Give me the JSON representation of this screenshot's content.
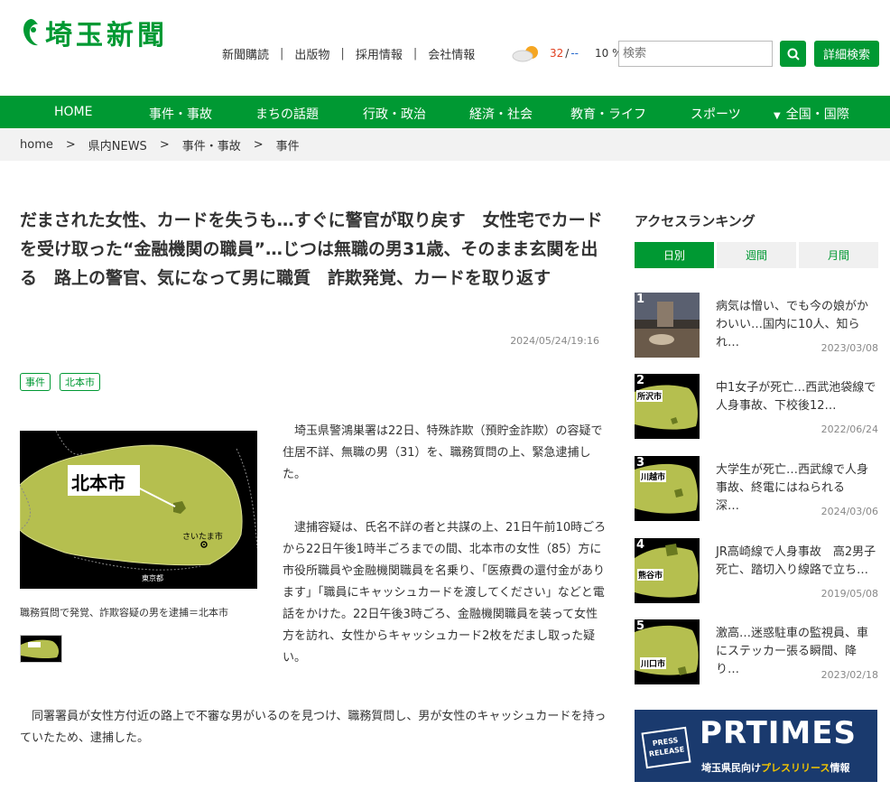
{
  "header": {
    "logo_text": "埼玉新聞",
    "links": [
      "新聞購読",
      "出版物",
      "採用情報",
      "会社情報"
    ],
    "weather": {
      "high": "32",
      "low": "--",
      "rain": "10 %"
    },
    "search_placeholder": "検索",
    "advanced_search": "詳細検索"
  },
  "nav": {
    "items": [
      "HOME",
      "事件・事故",
      "まちの話題",
      "行政・政治",
      "経済・社会",
      "教育・ライフ",
      "スポーツ",
      "全国・国際"
    ]
  },
  "breadcrumb": [
    "home",
    "県内NEWS",
    "事件・事故",
    "事件"
  ],
  "article": {
    "title": "だまされた女性、カードを失うも…すぐに警官が取り戻す　女性宅でカードを受け取った“金融機関の職員”…じつは無職の男31歳、そのまま玄関を出る　路上の警官、気になって男に職質　詐欺発覚、カードを取り返す",
    "date": "2024/05/24/19:16",
    "tags": [
      "事件",
      "北本市"
    ],
    "map_label": "北本市",
    "map_city": "さいたま市",
    "map_tokyo": "東京都",
    "caption": "職務質問で発覚、詐欺容疑の男を逮捕＝北本市",
    "paragraphs": [
      "　埼玉県警鴻巣署は22日、特殊詐欺（預貯金詐欺）の容疑で住居不詳、無職の男（31）を、職務質問の上、緊急逮捕した。",
      "　逮捕容疑は、氏名不詳の者と共謀の上、21日午前10時ごろから22日午後1時半ごろまでの間、北本市の女性（85）方に市役所職員や金融機関職員を名乗り、「医療費の還付金があります」「職員にキャッシュカードを渡してください」などと電話をかけた。22日午後3時ごろ、金融機関職員を装って女性方を訪れ、女性からキャッシュカード2枚をだまし取った疑い。",
      "　同署署員が女性方付近の路上で不審な男がいるのを見つけ、職務質問し、男が女性のキャッシュカードを持っていたため、逮捕した。"
    ]
  },
  "sidebar": {
    "title": "アクセスランキング",
    "tabs": [
      "日別",
      "週間",
      "月間"
    ],
    "ranking": [
      {
        "num": "1",
        "title": "病気は憎い、でも今の娘がかわいい…国内に10人、知られ…",
        "date": "2023/03/08"
      },
      {
        "num": "2",
        "title": "中1女子が死亡…西武池袋線で人身事故、下校後12…",
        "date": "2022/06/24",
        "map_label": "所沢市"
      },
      {
        "num": "3",
        "title": "大学生が死亡…西武線で人身事故、終電にはねられる　深…",
        "date": "2024/03/06",
        "map_label": "川越市"
      },
      {
        "num": "4",
        "title": "JR高崎線で人身事故　高2男子死亡、踏切入り線路で立ち…",
        "date": "2019/05/08",
        "map_label": "熊谷市"
      },
      {
        "num": "5",
        "title": "激高…迷惑駐車の監視員、車にステッカー張る瞬間、降り…",
        "date": "2023/02/18",
        "map_label": "川口市"
      }
    ],
    "pr_banner": {
      "logo": "PRTIMES",
      "badge": "PRESS RELEASE",
      "sub_a": "埼玉県民向け",
      "sub_b": "プレスリリース",
      "sub_c": "情報"
    }
  },
  "colors": {
    "brand_green": "#009933",
    "nav_bg": "#009933",
    "map_fill": "#b5bf4f",
    "pr_bg": "#1a3a6e"
  }
}
